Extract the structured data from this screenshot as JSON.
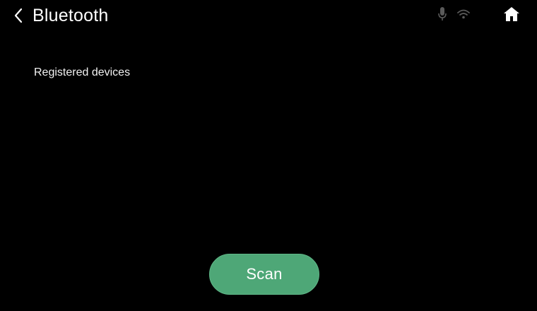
{
  "header": {
    "title": "Bluetooth",
    "back_icon": "chevron-left-icon",
    "status_icons": [
      "microphone-icon",
      "wifi-icon"
    ],
    "home_icon": "home-icon"
  },
  "main": {
    "section_label": "Registered devices"
  },
  "actions": {
    "scan_label": "Scan"
  },
  "colors": {
    "background": "#000000",
    "text": "#ffffff",
    "status_icon": "#5a5a5a",
    "scan_button": "#4ea777"
  }
}
